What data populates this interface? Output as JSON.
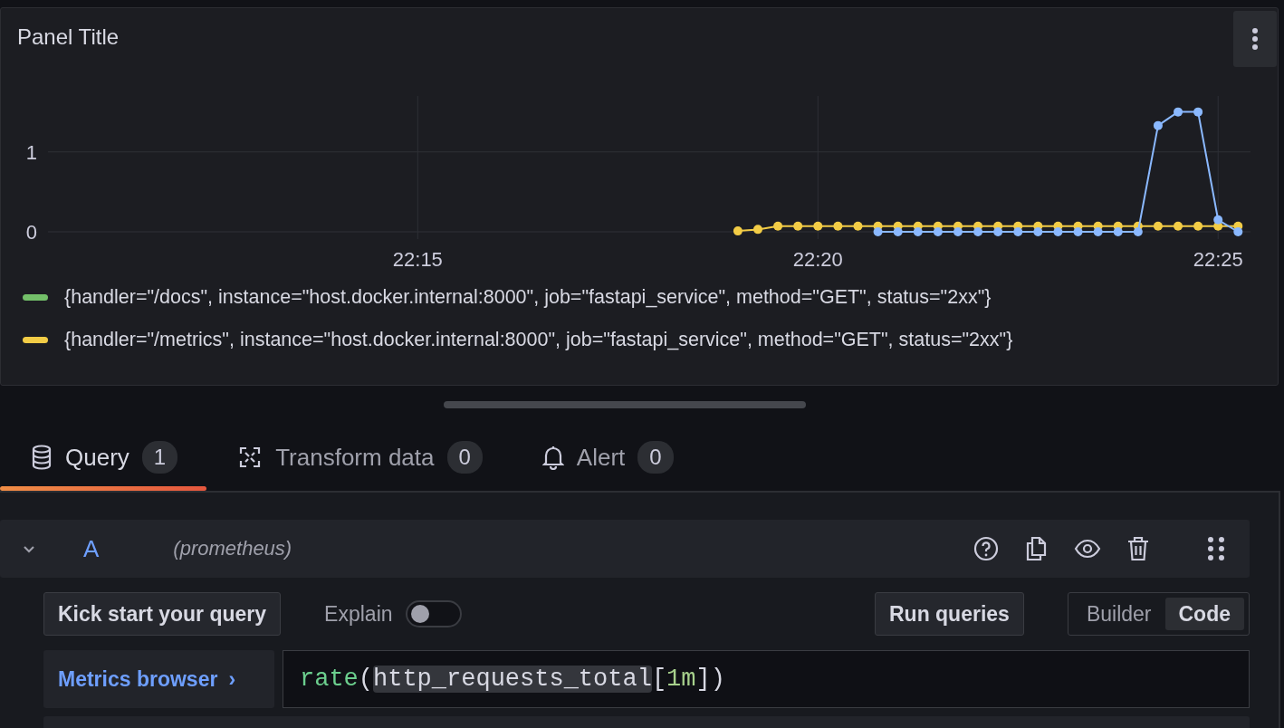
{
  "panel": {
    "title": "Panel Title",
    "chart_data": {
      "type": "line",
      "categories": [
        null,
        null,
        null,
        null,
        null,
        null,
        null,
        null,
        null,
        null,
        null,
        null,
        null,
        null,
        null,
        null,
        null,
        null,
        "22:15",
        null,
        null,
        null,
        null,
        null,
        null,
        null,
        null,
        null,
        null,
        null,
        null,
        null,
        null,
        null,
        null,
        null,
        null,
        null,
        "22:20",
        null,
        null,
        null,
        null,
        null,
        null,
        null,
        null,
        null,
        null,
        null,
        null,
        null,
        null,
        null,
        null,
        null,
        null,
        null,
        "22:25",
        null
      ],
      "series": [
        {
          "color": "#f2cc46",
          "marker": true,
          "values": [
            null,
            null,
            null,
            null,
            null,
            null,
            null,
            null,
            null,
            null,
            null,
            null,
            null,
            null,
            null,
            null,
            null,
            null,
            null,
            null,
            null,
            null,
            null,
            null,
            null,
            null,
            null,
            null,
            null,
            null,
            null,
            null,
            null,
            null,
            0.01,
            0.03,
            0.07,
            0.07,
            0.07,
            0.07,
            0.07,
            0.07,
            0.07,
            0.07,
            0.07,
            0.07,
            0.07,
            0.07,
            0.07,
            0.07,
            0.07,
            0.07,
            0.07,
            0.07,
            0.07,
            0.07,
            0.07,
            0.07,
            0.07,
            0.07
          ]
        },
        {
          "color": "#8ab8ff",
          "marker": true,
          "values": [
            null,
            null,
            null,
            null,
            null,
            null,
            null,
            null,
            null,
            null,
            null,
            null,
            null,
            null,
            null,
            null,
            null,
            null,
            null,
            null,
            null,
            null,
            null,
            null,
            null,
            null,
            null,
            null,
            null,
            null,
            null,
            null,
            null,
            null,
            null,
            null,
            null,
            null,
            null,
            null,
            null,
            0,
            0,
            0,
            0,
            0,
            0,
            0,
            0,
            0,
            0,
            0,
            0,
            0,
            0,
            1.33,
            1.5,
            1.5,
            0.15,
            0
          ]
        }
      ],
      "ylim": [
        0,
        1.7
      ],
      "grid": true,
      "yticks": [
        0,
        1
      ]
    },
    "legend": [
      {
        "label": "{handler=\"/docs\", instance=\"host.docker.internal:8000\", job=\"fastapi_service\", method=\"GET\", status=\"2xx\"}",
        "color": "#73bf69"
      },
      {
        "label": "{handler=\"/metrics\", instance=\"host.docker.internal:8000\", job=\"fastapi_service\", method=\"GET\", status=\"2xx\"}",
        "color": "#f2cc46"
      }
    ]
  },
  "tabs": [
    {
      "label": "Query",
      "count": "1",
      "selected": true
    },
    {
      "label": "Transform data",
      "count": "0",
      "selected": false
    },
    {
      "label": "Alert",
      "count": "0",
      "selected": false
    }
  ],
  "query": {
    "ref": "A",
    "datasource": "(prometheus)",
    "expanded": true,
    "kick_start": "Kick start your query",
    "explain": {
      "label": "Explain",
      "on": false
    },
    "run": "Run queries",
    "modes": [
      {
        "label": "Builder",
        "selected": false
      },
      {
        "label": "Code",
        "selected": true
      }
    ],
    "metrics_browser": "Metrics browser",
    "metrics_browser_arrow": "›",
    "code": [
      {
        "text": "rate",
        "kind": "function",
        "highlighted": false
      },
      {
        "text": "(",
        "kind": "punct",
        "highlighted": false
      },
      {
        "text": "http_requests_total",
        "kind": "metric",
        "highlighted": true
      },
      {
        "text": "[",
        "kind": "punct",
        "highlighted": false
      },
      {
        "text": "1m",
        "kind": "duration",
        "highlighted": false
      },
      {
        "text": "])",
        "kind": "punct",
        "highlighted": false
      }
    ]
  }
}
